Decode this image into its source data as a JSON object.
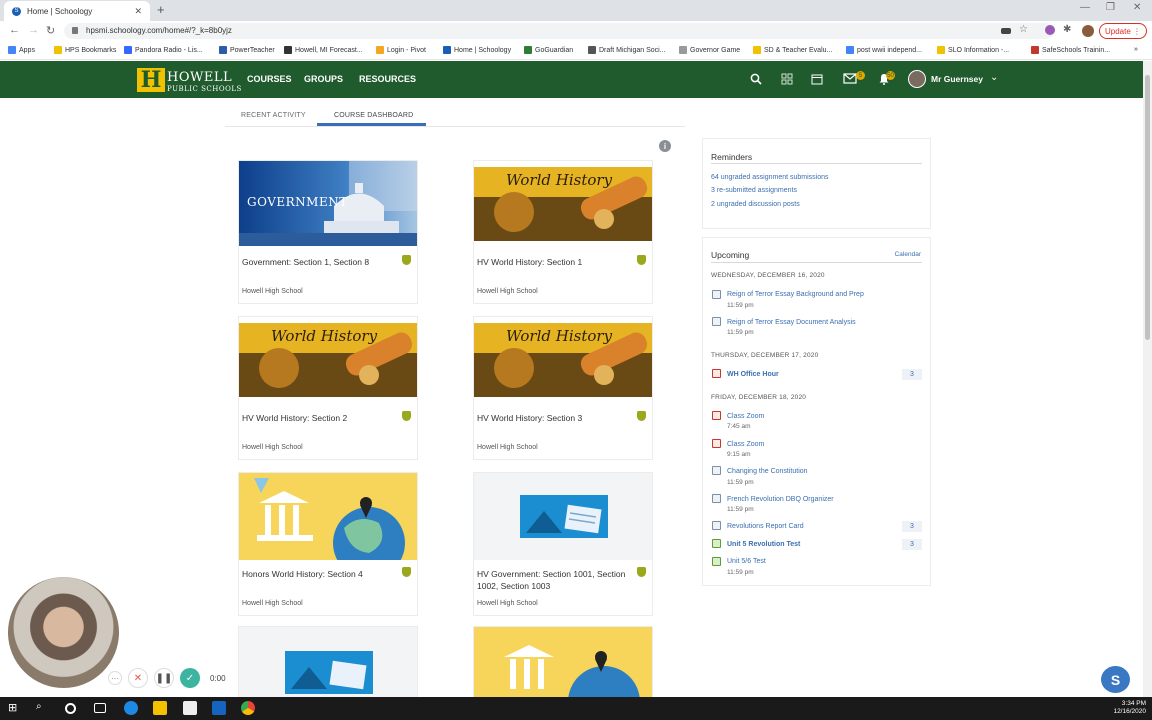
{
  "browser": {
    "tab_title": "Home | Schoology",
    "url": "hpsmi.schoology.com/home#/?_k=8b0yjz",
    "update_label": "Update",
    "bookmarks": [
      "Apps",
      "HPS Bookmarks",
      "Pandora Radio - Lis...",
      "PowerTeacher",
      "Howell, MI Forecast...",
      "Login - Pivot",
      "Home | Schoology",
      "GoGuardian",
      "Draft Michigan Soci...",
      "Governor Game",
      "SD & Teacher Evalu...",
      "post wwii independ...",
      "SLO Information -...",
      "SafeSchools Trainin..."
    ]
  },
  "header": {
    "logo_mark": "H",
    "logo_text": "HOWELL",
    "logo_sub": "PUBLIC SCHOOLS",
    "nav": [
      "COURSES",
      "GROUPS",
      "RESOURCES"
    ],
    "mail_badge": "5",
    "notif_badge": "50",
    "user_name": "Mr Guernsey"
  },
  "tabs": [
    "RECENT ACTIVITY",
    "COURSE DASHBOARD"
  ],
  "courses": [
    {
      "title": "Government: Section 1, Section 8",
      "school": "Howell High School",
      "image": "government"
    },
    {
      "title": "HV World History: Section 1",
      "school": "Howell High School",
      "image": "world-history"
    },
    {
      "title": "HV World History: Section 2",
      "school": "Howell High School",
      "image": "world-history"
    },
    {
      "title": "HV World History: Section 3",
      "school": "Howell High School",
      "image": "world-history"
    },
    {
      "title": "Honors World History: Section 4",
      "school": "Howell High School",
      "image": "globe"
    },
    {
      "title": "HV Government: Section 1001, Section 1002, Section 1003",
      "school": "Howell High School",
      "image": "blue-doc"
    }
  ],
  "image_text": {
    "government": "GOVERNMENT",
    "world_history": "World History"
  },
  "reminders": {
    "title": "Reminders",
    "items": [
      "64 ungraded assignment submissions",
      "3 re-submitted assignments",
      "2 ungraded discussion posts"
    ]
  },
  "upcoming": {
    "title": "Upcoming",
    "calendar_label": "Calendar",
    "days": [
      {
        "label": "WEDNESDAY, DECEMBER 16, 2020",
        "events": [
          {
            "title": "Reign of Terror Essay Background and Prep",
            "time": "11:59 pm"
          },
          {
            "title": "Reign of Terror Essay Document Analysis",
            "time": "11:59 pm"
          }
        ]
      },
      {
        "label": "THURSDAY, DECEMBER 17, 2020",
        "events": [
          {
            "title": "WH Office Hour",
            "count": "3"
          }
        ]
      },
      {
        "label": "FRIDAY, DECEMBER 18, 2020",
        "events": [
          {
            "title": "Class Zoom",
            "time": "7:45 am"
          },
          {
            "title": "Class Zoom",
            "time": "9:15 am"
          },
          {
            "title": "Changing the Constitution",
            "time": "11:59 pm"
          },
          {
            "title": "French Revolution DBQ Organizer",
            "time": "11:59 pm"
          },
          {
            "title": "Revolutions Report Card",
            "count": "3"
          },
          {
            "title": "Unit 5 Revolution Test",
            "count": "3"
          },
          {
            "title": "Unit 5/6 Test",
            "time": "11:59 pm"
          }
        ]
      }
    ]
  },
  "recorder": {
    "timer": "0:00"
  },
  "fab_label": "S",
  "clock": {
    "time": "3:34 PM",
    "date": "12/16/2020"
  },
  "colors": {
    "brand_green": "#1f5b2c",
    "brand_gold": "#f2c200",
    "link_blue": "#3a6fb0"
  }
}
